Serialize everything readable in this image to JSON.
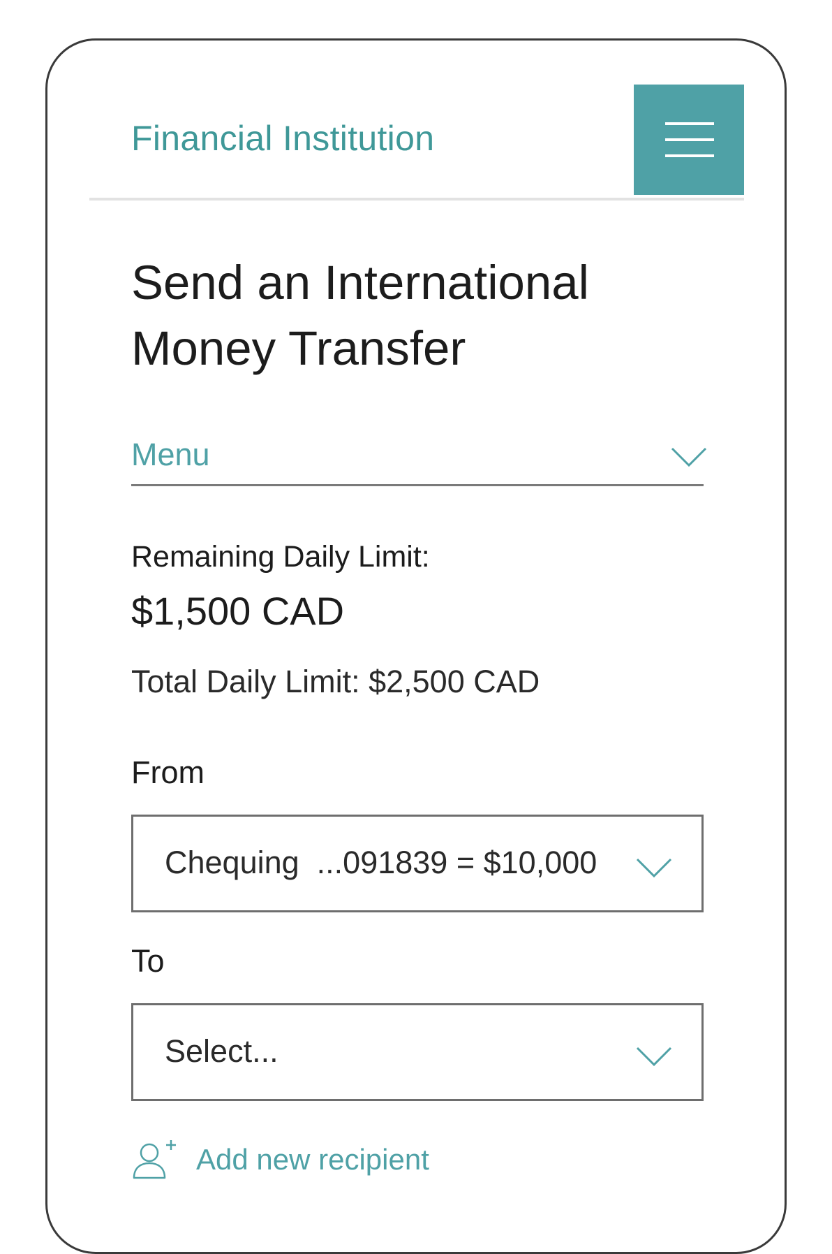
{
  "header": {
    "brand": "Financial Institution",
    "menu_icon": "hamburger-icon"
  },
  "page": {
    "title_line1": "Send an International",
    "title_line2": "Money Transfer"
  },
  "menu_select": {
    "label": "Menu",
    "icon": "chevron-down-icon"
  },
  "limits": {
    "remaining_label": "Remaining Daily Limit:",
    "remaining_value": "$1,500 CAD",
    "total_text": "Total Daily Limit: $2,500 CAD"
  },
  "from": {
    "label": "From",
    "value": "Chequing  ...091839 = $10,000"
  },
  "to": {
    "label": "To",
    "value": "Select..."
  },
  "add_recipient": {
    "label": "Add new recipient",
    "icon": "add-user-icon"
  },
  "colors": {
    "accent": "#4fa1a6",
    "brand_text": "#3f9898",
    "divider": "#e2e2e2",
    "border": "#6e6e6e"
  }
}
